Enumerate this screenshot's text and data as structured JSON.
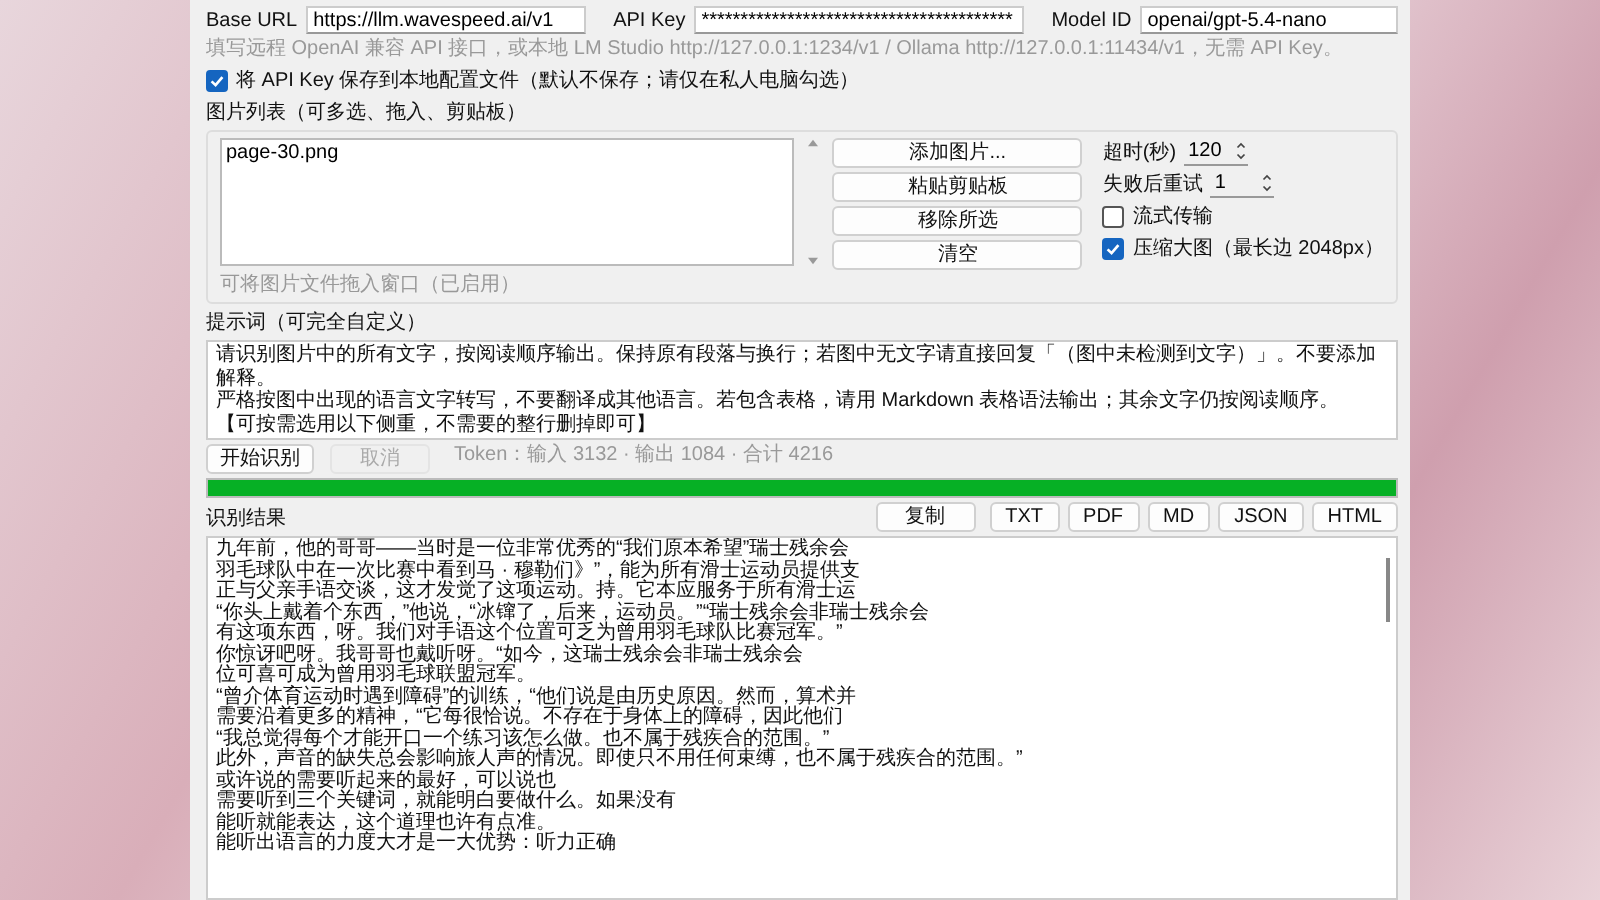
{
  "connection": {
    "base_url_label": "Base URL",
    "base_url": "https://llm.wavespeed.ai/v1",
    "api_key_label": "API Key",
    "api_key": "****************************************",
    "model_label": "Model ID",
    "model": "openai/gpt-5.4-nano",
    "hint": "填写远程 OpenAI 兼容 API 接口，或本地 LM Studio http://127.0.0.1:1234/v1 / Ollama http://127.0.0.1:11434/v1，无需 API Key。"
  },
  "save_key": {
    "label": "将 API Key 保存到本地配置文件（默认不保存；请仅在私人电脑勾选）",
    "checked": true
  },
  "images": {
    "title": "图片列表（可多选、拖入、剪贴板）",
    "files": [
      {
        "name": "page-30.png",
        "selected": false
      }
    ],
    "buttons": [
      "添加图片...",
      "粘贴剪贴板",
      "移除所选",
      "清空"
    ],
    "timeout_label": "超时(秒)",
    "timeout": "120",
    "retry_label": "失败后重试",
    "retry": "1",
    "options": [
      {
        "label": "流式传输",
        "checked": false
      },
      {
        "label": "压缩大图（最长边 2048px）",
        "checked": true
      }
    ],
    "drop_hint": "可将图片文件拖入窗口（已启用）"
  },
  "prompt": {
    "title": "提示词（可完全自定义）",
    "lines": [
      "请识别图片中的所有文字，按阅读顺序输出。保持原有段落与换行；若图中无文字请直接回复「（图中未检测到文字）」。不要添加解释。",
      "严格按图中出现的语言文字转写，不要翻译成其他语言。若包含表格，请用 Markdown 表格语法输出；其余文字仍按阅读顺序。",
      "【可按需选用以下侧重，不需要的整行删掉即可】"
    ]
  },
  "run": {
    "start": "开始识别",
    "cancel": "取消",
    "cancel_disabled": true,
    "tokens": "Token：输入 3132 · 输出 1084 · 合计 4216",
    "level": 1.0
  },
  "result": {
    "title": "识别结果",
    "buttons": [
      "复制",
      "TXT",
      "PDF",
      "MD",
      "JSON",
      "HTML"
    ],
    "lines": [
      "九年前，他的哥哥——当时是一位非常优秀的“我们原本希望”瑞士残余会",
      "羽毛球队中在一次比赛中看到马 · 穆勒们》”，能为所有滑士运动员提供支",
      "正与父亲手语交谈，这才发觉了这项运动。持。它本应服务于所有滑士运",
      "“你头上戴着个东西，”他说，“冰镩了，后来，运动员。”“瑞士残余会非瑞士残余会",
      "有这项东西，呀。我们对手语这个位置可乏为曾用羽毛球队比赛冠军。”",
      "你惊讶吧呀。我哥哥也戴听呀。“如今，这瑞士残余会非瑞士残余会",
      "位可喜可成为曾用羽毛球联盟冠军。",
      "“曾介体育运动时遇到障碍”的训练，“他们说是由历史原因。然而，算术并",
      "需要沿着更多的精神，“它每很恰说。不存在于身体上的障碍，因此他们",
      "“我总觉得每个才能开口一个练习该怎么做。也不属于残疾合的范围。”",
      "此外，声音的缺失总会影响旅人声的情况。即使只不用任何束缚，也不属于残疾合的范围。”",
      "或许说的需要听起来的最好，可以说也",
      "需要听到三个关键词，就能明白要做什么。如果没有",
      "能听就能表达，这个道理也许有点准。",
      "能听出语言的力度大才是一大优势：听力正确"
    ]
  }
}
